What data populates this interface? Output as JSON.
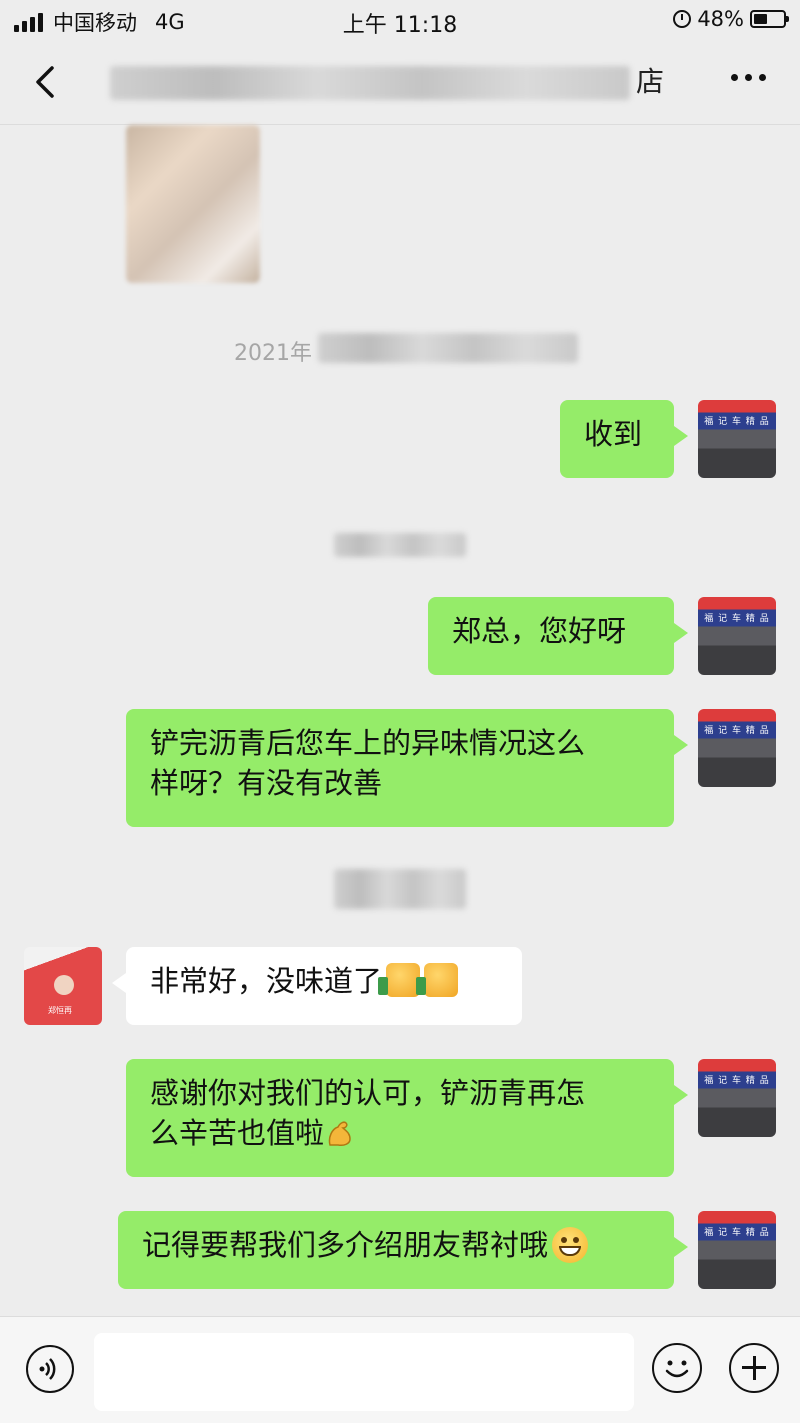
{
  "status_bar": {
    "carrier": "中国移动",
    "network": "4G",
    "time": "上午 11:18",
    "battery": "48%",
    "battery_level": 0.48
  },
  "nav": {
    "title_visible_fragment": "店",
    "back_icon": "chevron-left-icon",
    "more_icon": "ellipsis-icon"
  },
  "chat": {
    "time_divider_1": "2021年",
    "messages": [
      {
        "sender": "me",
        "text": "收到"
      },
      {
        "sender": "me",
        "text": "郑总，您好呀"
      },
      {
        "sender": "me",
        "line1": "铲完沥青后您车上的异味情况这么",
        "line2": "样呀？有没有改善"
      },
      {
        "sender": "other",
        "text": "非常好，没味道了",
        "emoji": "thumbs-up-icon"
      },
      {
        "sender": "me",
        "line1": "感谢你对我们的认可，铲沥青再怎",
        "line2": "么辛苦也值啦",
        "emoji": "flexed-biceps-icon"
      },
      {
        "sender": "me",
        "text": "记得要帮我们多介绍朋友帮衬哦",
        "emoji": "grinning-face-icon"
      }
    ],
    "shop_sign_text": "福 记 车 精 品",
    "contact_card_name": "郑恒再"
  },
  "input_bar": {
    "voice_icon": "voice-icon",
    "emoji_icon": "smiley-icon",
    "plus_icon": "plus-icon"
  },
  "colors": {
    "background": "#ededed",
    "my_bubble": "#95ec69",
    "other_bubble": "#ffffff"
  }
}
